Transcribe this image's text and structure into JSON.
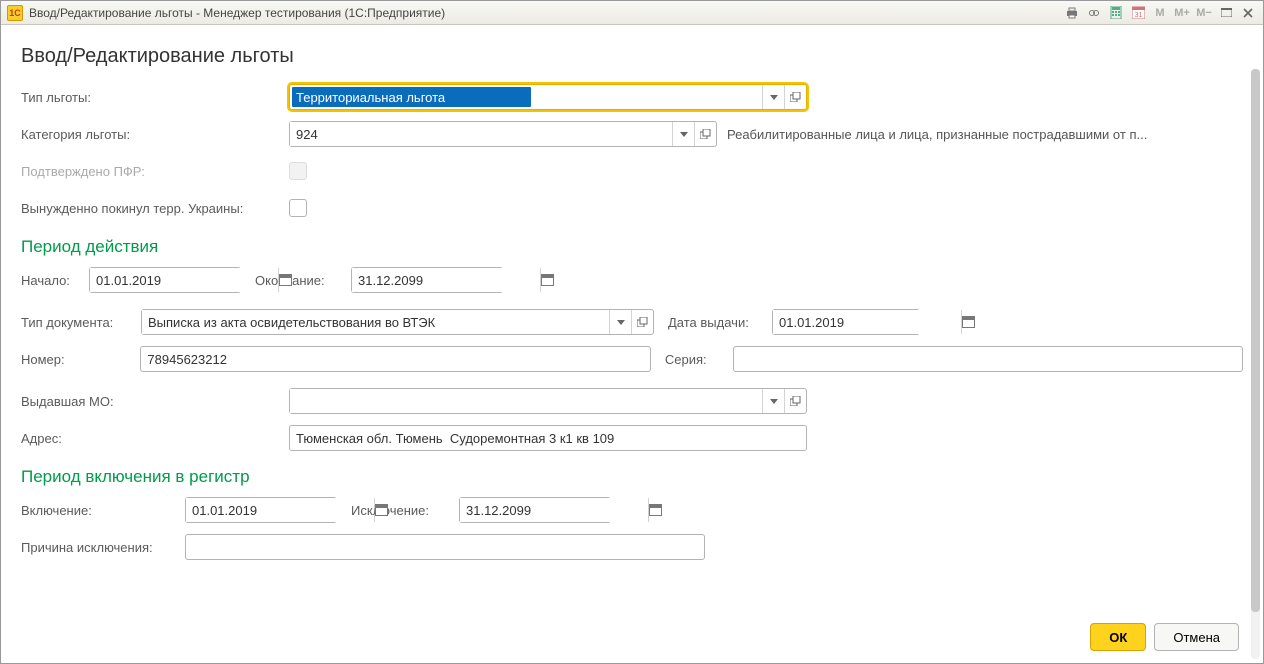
{
  "window": {
    "app_icon": "1C",
    "title": "Ввод/Редактирование льготы  - Менеджер тестирования (1С:Предприятие)"
  },
  "page_title": "Ввод/Редактирование льготы",
  "benefit_type": {
    "label": "Тип льготы:",
    "value": "Территориальная льгота"
  },
  "benefit_category": {
    "label": "Категория льготы:",
    "value": "924",
    "description": "Реабилитированные лица и лица, признанные пострадавшими от п..."
  },
  "confirmed_pfr": {
    "label": "Подтверждено ПФР:"
  },
  "left_ukraine": {
    "label": "Вынужденно покинул терр. Украины:"
  },
  "period_action": {
    "header": "Период действия",
    "start_label": "Начало:",
    "start_value": "01.01.2019",
    "end_label": "Окончание:",
    "end_value": "31.12.2099"
  },
  "doc_type": {
    "label": "Тип документа:",
    "value": "Выписка из акта освидетельствования во ВТЭК"
  },
  "issue_date": {
    "label": "Дата выдачи:",
    "value": "01.01.2019"
  },
  "number": {
    "label": "Номер:",
    "value": "78945623212"
  },
  "series": {
    "label": "Серия:",
    "value": ""
  },
  "issued_mo": {
    "label": "Выдавшая МО:",
    "value": ""
  },
  "address": {
    "label": "Адрес:",
    "value": "Тюменская обл. Тюмень  Судоремонтная 3 к1 кв 109"
  },
  "period_register": {
    "header": "Период включения в регистр",
    "include_label": "Включение:",
    "include_value": "01.01.2019",
    "exclude_label": "Исключение:",
    "exclude_value": "31.12.2099"
  },
  "exclusion_reason": {
    "label": "Причина исключения:",
    "value": ""
  },
  "buttons": {
    "ok": "ОК",
    "cancel": "Отмена"
  }
}
